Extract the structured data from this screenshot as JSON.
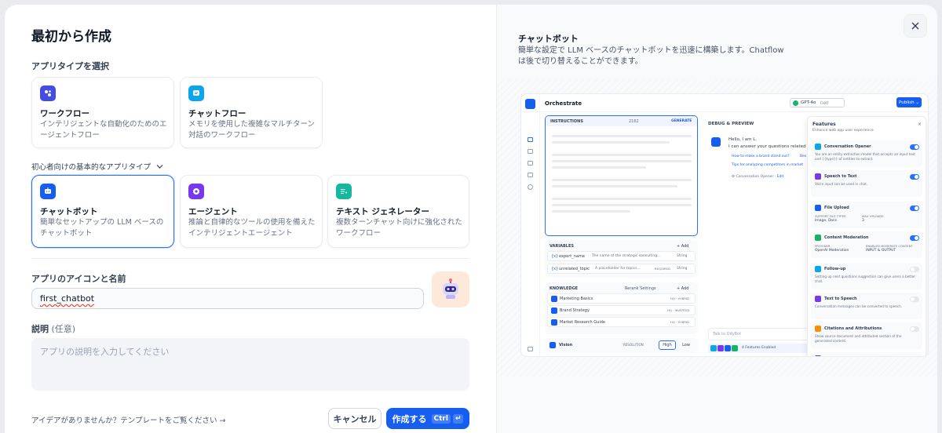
{
  "left": {
    "title": "最初から作成",
    "app_type_label": "アプリタイプを選択",
    "top_cards": [
      {
        "name": "ワークフロー",
        "desc": "インテリジェントな自動化のためのエージェントフロー",
        "icon": "workflow-icon",
        "color": "#444ce7"
      },
      {
        "name": "チャットフロー",
        "desc": "メモリを使用した複雑なマルチターン対話のワークフロー",
        "icon": "chatflow-icon",
        "color": "#0ba5ec"
      }
    ],
    "beginner_label": "初心者向けの基本的なアプリタイプ",
    "basic_cards": [
      {
        "name": "チャットボット",
        "desc": "簡単なセットアップの LLM ベースのチャットボット",
        "icon": "chatbot-icon",
        "color": "#155eef"
      },
      {
        "name": "エージェント",
        "desc": "推論と自律的なツールの使用を備えたインテリジェントエージェント",
        "icon": "agent-icon",
        "color": "#7839ee"
      },
      {
        "name": "テキスト ジェネレーター",
        "desc": "複数ターンチャット向けに強化されたワークフロー",
        "icon": "text-generator-icon",
        "color": "#15b79e"
      }
    ],
    "name_label": "アプリのアイコンと名前",
    "name_value": "first_chatbot",
    "desc_label": "説明",
    "desc_optional": "(任意)",
    "desc_placeholder": "アプリの説明を入力してください",
    "template_hint": "アイデアがありませんか？テンプレートをご覧ください",
    "cancel": "キャンセル",
    "create": "作成する",
    "shortcut": "Ctrl"
  },
  "right": {
    "title": "チャットボット",
    "desc": "簡単な設定で LLM ベースのチャットボットを迅速に構築します。Chatflow は後で切り替えることができます。",
    "preview": {
      "orchestrate": "Orchestrate",
      "model": "GPT-4o",
      "model_tag": "CHAT",
      "publish": "Publish",
      "instructions": "INSTRUCTIONS",
      "instr_count": "2162",
      "generate": "GENERATE",
      "variables": "VARIABLES",
      "add": "Add",
      "vars": [
        {
          "name": "expert_name",
          "desc": "The name of the strategic consulting...",
          "type": "String",
          "tag": ""
        },
        {
          "name": "unrelated_topic",
          "desc": "A placeholder for topics...",
          "type": "String",
          "tag": "REQUIRED"
        }
      ],
      "knowledge": "KNOWLEDGE",
      "rerank": "Rerank Settings",
      "kb": [
        {
          "name": "Marketing Basics",
          "tag": "HQ · HYBRID"
        },
        {
          "name": "Brand Strategy",
          "tag": "HQ · INVERTED"
        },
        {
          "name": "Market Research Guide",
          "tag": "HQ · HYBRID"
        }
      ],
      "vision": "Vision",
      "resolution": "RESOLUTION",
      "high": "High",
      "low": "Low",
      "debug": "DEBUG & PREVIEW",
      "greet1": "Hello, I am L.",
      "greet2": "I can answer your questions related",
      "sugg1": "How to make a brand stand out?",
      "sugg1b": "Bes",
      "sugg2": "Tips for analyzing competitors in market",
      "opener": "Conversation Opener",
      "edit": "Edit",
      "talk": "Talk to DifyBot",
      "features_enabled": "4 Features Enabled",
      "features_title": "Features",
      "features_sub": "Enhance web app user experience",
      "features": [
        {
          "name": "Conversation Opener",
          "desc": "You are an entity extraction model that accepts an input text and {{type}} of entities to extract.",
          "on": true,
          "color": "#0ba5ec"
        },
        {
          "name": "Speech to Text",
          "desc": "Voice input can be used in chat.",
          "on": true,
          "color": "#7839ee"
        },
        {
          "name": "File Upload",
          "desc": "",
          "on": true,
          "color": "#155eef"
        },
        {
          "name": "Content Moderation",
          "desc": "",
          "on": true,
          "color": "#16b364"
        },
        {
          "name": "Follow-up",
          "desc": "Setting up next questions suggestion can give users a better chat.",
          "on": false,
          "color": "#0ba5ec"
        },
        {
          "name": "Text to Speech",
          "desc": "Conversation messages can be converted to speech.",
          "on": false,
          "color": "#7839ee"
        },
        {
          "name": "Citations and Attributions",
          "desc": "Show source document and attributed section of the generated content.",
          "on": false,
          "color": "#f79009"
        },
        {
          "name": "Annotation Reply",
          "desc": "",
          "on": false,
          "color": "#444ce7"
        }
      ],
      "file_types_label": "SUPPORT FILE TYPES",
      "file_types": "Image, Docs",
      "max_uploads_label": "MAX UPLOADS",
      "max_uploads": "3",
      "provider_label": "PROVIDER",
      "provider": "OpenAI Moderation",
      "enabled_label": "ENABLED MODERATE CONTENT",
      "enabled": "INPUT & OUTPUT"
    }
  }
}
